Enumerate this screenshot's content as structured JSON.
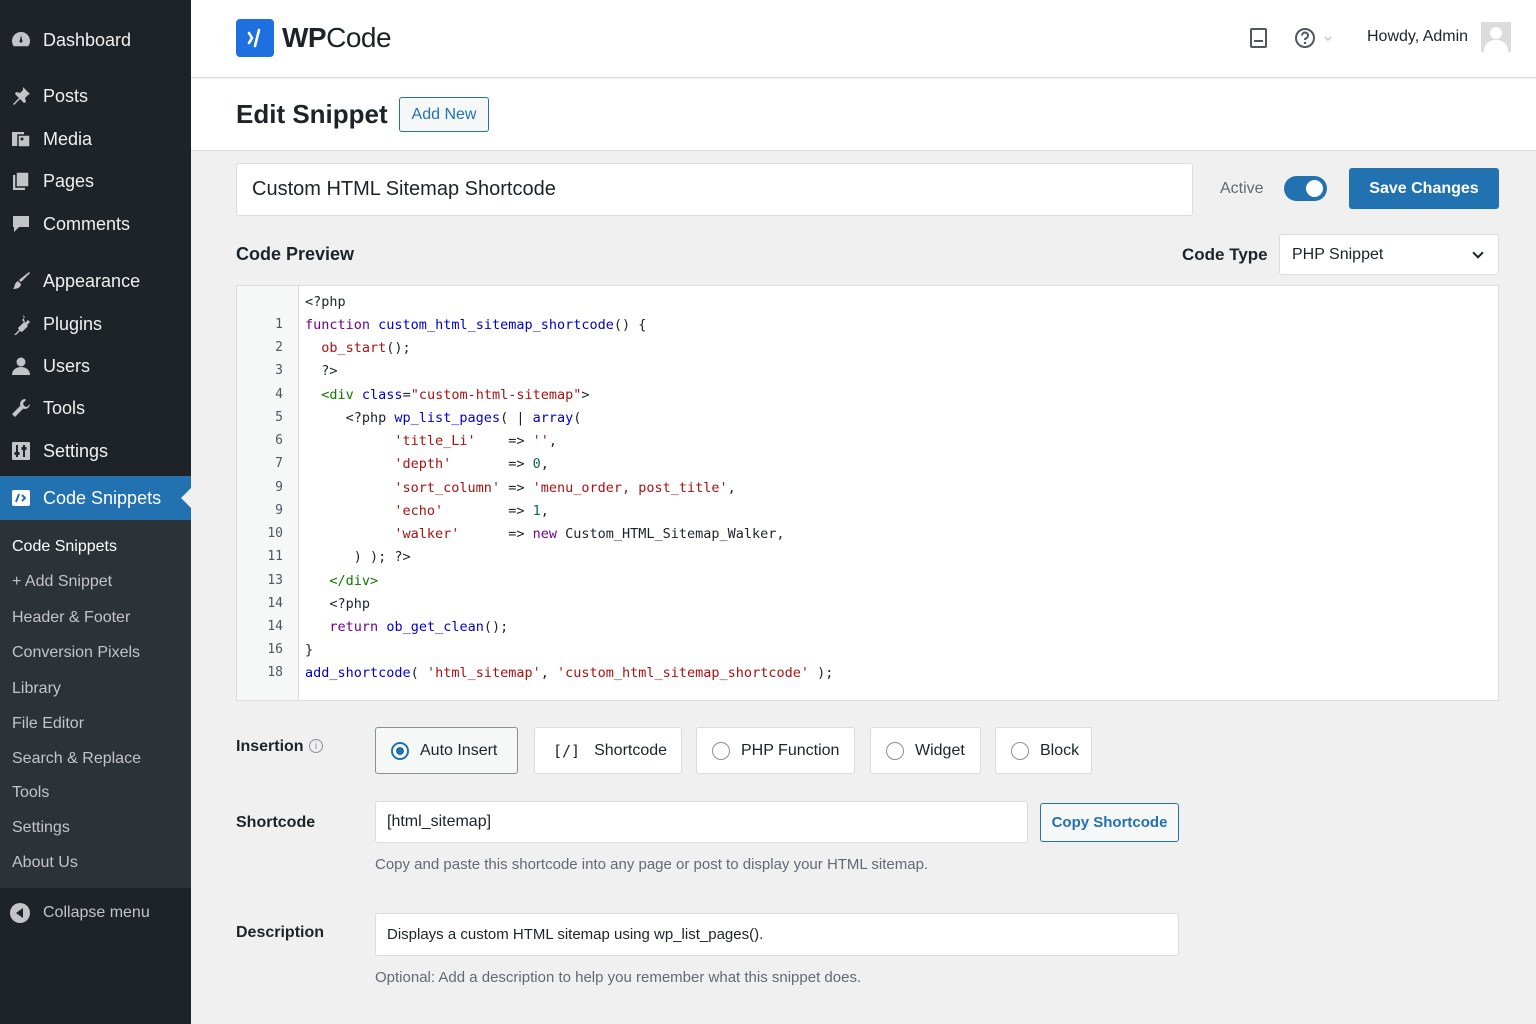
{
  "sidebar": {
    "dashboard": "Dashboard",
    "posts": "Posts",
    "media": "Media",
    "pages": "Pages",
    "comments": "Comments",
    "appearance": "Appearance",
    "plugins": "Plugins",
    "users": "Users",
    "tools": "Tools",
    "settings": "Settings",
    "code_snippets": "Code Snippets",
    "submenu": [
      "Code Snippets",
      "+ Add Snippet",
      "Header & Footer",
      "Conversion Pixels",
      "Library",
      "File Editor",
      "Search & Replace",
      "Tools",
      "Settings",
      "About Us"
    ],
    "collapse": "Collapse menu"
  },
  "topbar": {
    "logo_bold": "WP",
    "logo_rest": "Code",
    "howdy": "Howdy, Admin"
  },
  "header": {
    "title": "Edit Snippet",
    "add_new": "Add New"
  },
  "snippet": {
    "title": "Custom HTML Sitemap Shortcode",
    "active_label": "Active",
    "active": true,
    "save_label": "Save Changes"
  },
  "code": {
    "preview_label": "Code Preview",
    "type_label": "Code Type",
    "type_value": "PHP Snippet",
    "line_numbers": [
      "",
      "1",
      "2",
      "3",
      "4",
      "5",
      "6",
      "7",
      "9",
      "9",
      "10",
      "11",
      "13",
      "14",
      "14",
      "16",
      "18"
    ]
  },
  "insertion": {
    "label": "Insertion",
    "options": [
      "Auto Insert",
      "Shortcode",
      "PHP Function",
      "Widget",
      "Block"
    ],
    "shortcode_icon": "[/]",
    "selected": "Auto Insert"
  },
  "shortcode": {
    "label": "Shortcode",
    "value": "[html_sitemap]",
    "copy_label": "Copy Shortcode",
    "help": "Copy and paste this shortcode into any page or post to display your HTML sitemap."
  },
  "description": {
    "label": "Description",
    "value": "Displays a custom HTML sitemap using wp_list_pages().",
    "help": "Optional: Add a description to help you remember what this snippet does."
  },
  "colors": {
    "accent": "#2271b1",
    "sidebar_bg": "#1d2327",
    "logo_blue": "#1e6fe0"
  }
}
